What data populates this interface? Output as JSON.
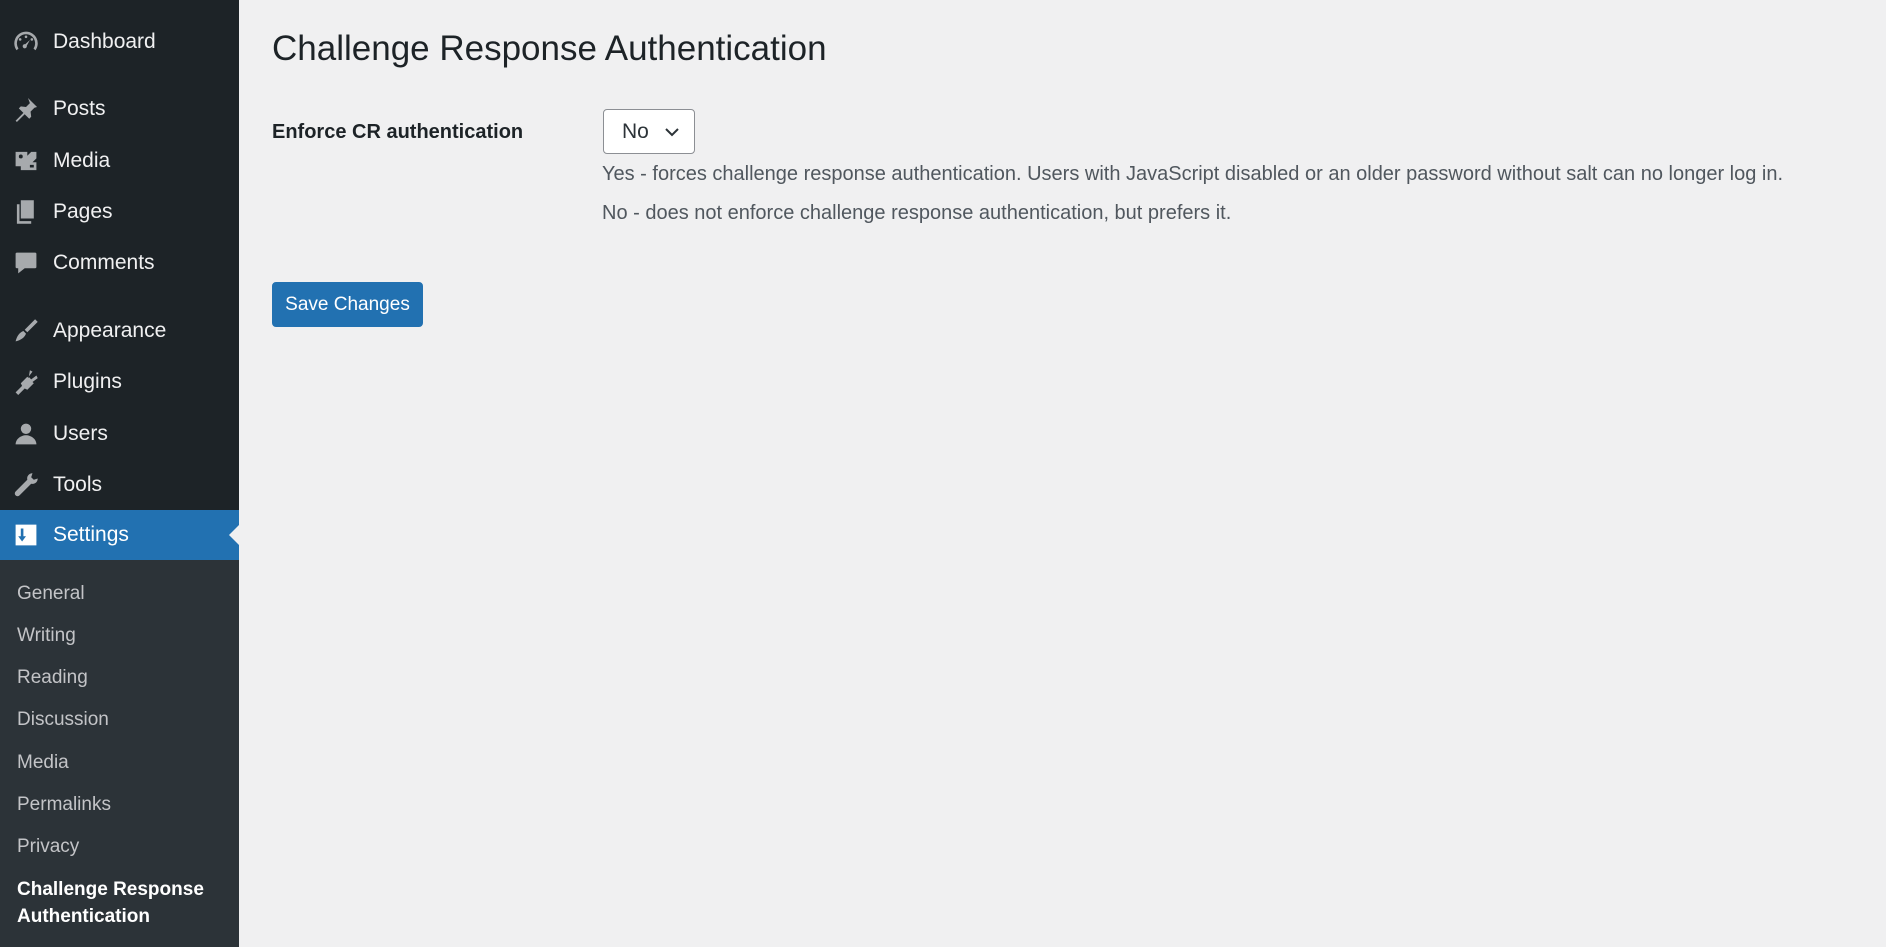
{
  "sidebar": {
    "items": [
      {
        "label": "Dashboard",
        "icon": "dashboard-icon"
      },
      {
        "label": "Posts",
        "icon": "pin-icon"
      },
      {
        "label": "Media",
        "icon": "media-icon"
      },
      {
        "label": "Pages",
        "icon": "pages-icon"
      },
      {
        "label": "Comments",
        "icon": "comment-icon"
      },
      {
        "label": "Appearance",
        "icon": "brush-icon"
      },
      {
        "label": "Plugins",
        "icon": "plugin-icon"
      },
      {
        "label": "Users",
        "icon": "user-icon"
      },
      {
        "label": "Tools",
        "icon": "wrench-icon"
      },
      {
        "label": "Settings",
        "icon": "settings-icon",
        "current": true
      }
    ],
    "submenu": [
      {
        "label": "General"
      },
      {
        "label": "Writing"
      },
      {
        "label": "Reading"
      },
      {
        "label": "Discussion"
      },
      {
        "label": "Media"
      },
      {
        "label": "Permalinks"
      },
      {
        "label": "Privacy"
      },
      {
        "label": "Challenge Response Authentication",
        "current": true
      }
    ]
  },
  "main": {
    "title": "Challenge Response Authentication",
    "field_label": "Enforce CR authentication",
    "select": {
      "value": "No"
    },
    "description_yes": "Yes - forces challenge response authentication. Users with JavaScript disabled or an older password without salt can no longer log in.",
    "description_no": "No - does not enforce challenge response authentication, but prefers it.",
    "save_label": "Save Changes"
  },
  "colors": {
    "sidebar_bg": "#1d2327",
    "submenu_bg": "#2c3338",
    "accent": "#2271b1",
    "page_bg": "#f0f0f1"
  }
}
